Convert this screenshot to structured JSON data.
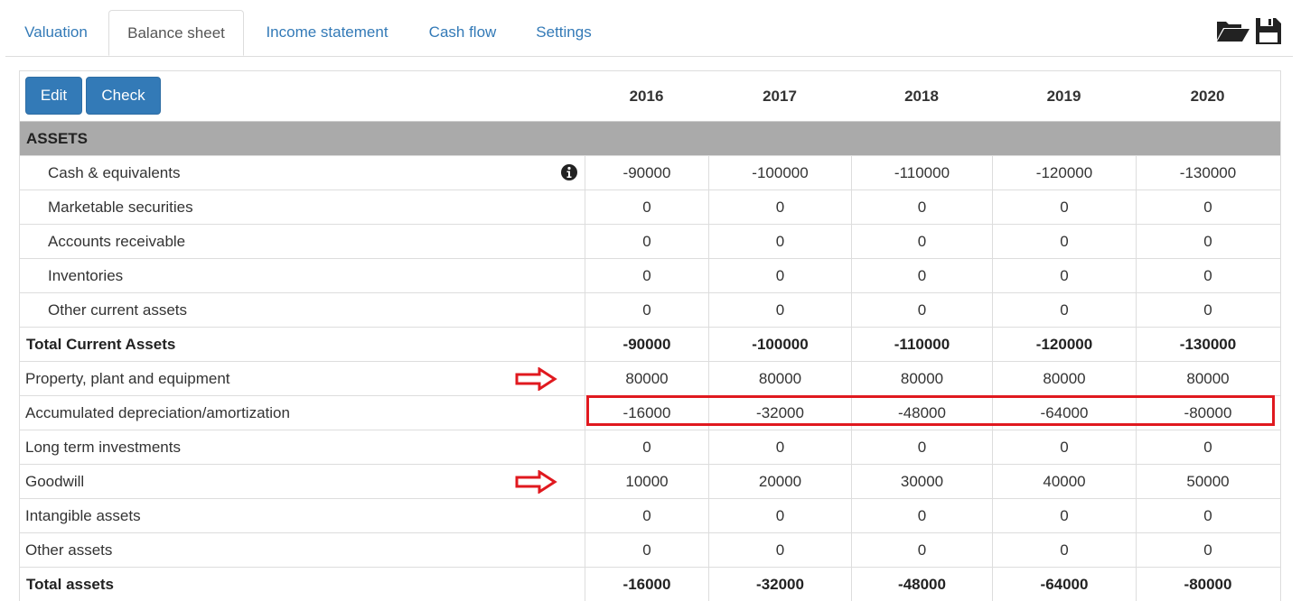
{
  "tabs": [
    {
      "label": "Valuation",
      "active": false
    },
    {
      "label": "Balance sheet",
      "active": true
    },
    {
      "label": "Income statement",
      "active": false
    },
    {
      "label": "Cash flow",
      "active": false
    },
    {
      "label": "Settings",
      "active": false
    }
  ],
  "toolbar": {
    "open_icon": "folder-open-icon",
    "save_icon": "floppy-disk-icon",
    "edit_label": "Edit",
    "check_label": "Check"
  },
  "years": [
    "2016",
    "2017",
    "2018",
    "2019",
    "2020"
  ],
  "section": "ASSETS",
  "rows": [
    {
      "label": "Cash & equivalents",
      "values": [
        "-90000",
        "-100000",
        "-110000",
        "-120000",
        "-130000"
      ],
      "indent": true,
      "info_icon": "info-circle-icon"
    },
    {
      "label": "Marketable securities",
      "values": [
        "0",
        "0",
        "0",
        "0",
        "0"
      ],
      "indent": true
    },
    {
      "label": "Accounts receivable",
      "values": [
        "0",
        "0",
        "0",
        "0",
        "0"
      ],
      "indent": true
    },
    {
      "label": "Inventories",
      "values": [
        "0",
        "0",
        "0",
        "0",
        "0"
      ],
      "indent": true
    },
    {
      "label": "Other current assets",
      "values": [
        "0",
        "0",
        "0",
        "0",
        "0"
      ],
      "indent": true
    },
    {
      "label": "Total Current Assets",
      "values": [
        "-90000",
        "-100000",
        "-110000",
        "-120000",
        "-130000"
      ],
      "total": true
    },
    {
      "label": "Property, plant and equipment",
      "values": [
        "80000",
        "80000",
        "80000",
        "80000",
        "80000"
      ],
      "annotation": "red-arrow-icon"
    },
    {
      "label": "Accumulated depreciation/amortization",
      "values": [
        "-16000",
        "-32000",
        "-48000",
        "-64000",
        "-80000"
      ],
      "annotation": "red-highlight-box"
    },
    {
      "label": "Long term investments",
      "values": [
        "0",
        "0",
        "0",
        "0",
        "0"
      ]
    },
    {
      "label": "Goodwill",
      "values": [
        "10000",
        "20000",
        "30000",
        "40000",
        "50000"
      ],
      "annotation": "red-arrow-icon"
    },
    {
      "label": "Intangible assets",
      "values": [
        "0",
        "0",
        "0",
        "0",
        "0"
      ]
    },
    {
      "label": "Other assets",
      "values": [
        "0",
        "0",
        "0",
        "0",
        "0"
      ]
    },
    {
      "label": "Total assets",
      "values": [
        "-16000",
        "-32000",
        "-48000",
        "-64000",
        "-80000"
      ],
      "total": true
    }
  ],
  "colors": {
    "link": "#337ab7",
    "button": "#337ab7",
    "section_bg": "#aaaaaa",
    "annotation_red": "#e0191f"
  }
}
